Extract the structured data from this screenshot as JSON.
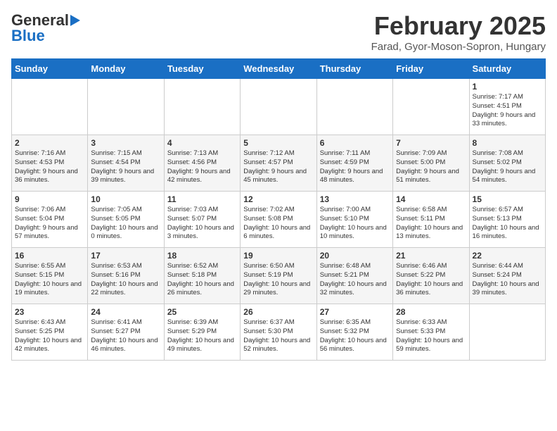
{
  "header": {
    "logo_general": "General",
    "logo_blue": "Blue",
    "month": "February 2025",
    "location": "Farad, Gyor-Moson-Sopron, Hungary"
  },
  "weekdays": [
    "Sunday",
    "Monday",
    "Tuesday",
    "Wednesday",
    "Thursday",
    "Friday",
    "Saturday"
  ],
  "weeks": [
    [
      {
        "day": "",
        "info": ""
      },
      {
        "day": "",
        "info": ""
      },
      {
        "day": "",
        "info": ""
      },
      {
        "day": "",
        "info": ""
      },
      {
        "day": "",
        "info": ""
      },
      {
        "day": "",
        "info": ""
      },
      {
        "day": "1",
        "info": "Sunrise: 7:17 AM\nSunset: 4:51 PM\nDaylight: 9 hours and 33 minutes."
      }
    ],
    [
      {
        "day": "2",
        "info": "Sunrise: 7:16 AM\nSunset: 4:53 PM\nDaylight: 9 hours and 36 minutes."
      },
      {
        "day": "3",
        "info": "Sunrise: 7:15 AM\nSunset: 4:54 PM\nDaylight: 9 hours and 39 minutes."
      },
      {
        "day": "4",
        "info": "Sunrise: 7:13 AM\nSunset: 4:56 PM\nDaylight: 9 hours and 42 minutes."
      },
      {
        "day": "5",
        "info": "Sunrise: 7:12 AM\nSunset: 4:57 PM\nDaylight: 9 hours and 45 minutes."
      },
      {
        "day": "6",
        "info": "Sunrise: 7:11 AM\nSunset: 4:59 PM\nDaylight: 9 hours and 48 minutes."
      },
      {
        "day": "7",
        "info": "Sunrise: 7:09 AM\nSunset: 5:00 PM\nDaylight: 9 hours and 51 minutes."
      },
      {
        "day": "8",
        "info": "Sunrise: 7:08 AM\nSunset: 5:02 PM\nDaylight: 9 hours and 54 minutes."
      }
    ],
    [
      {
        "day": "9",
        "info": "Sunrise: 7:06 AM\nSunset: 5:04 PM\nDaylight: 9 hours and 57 minutes."
      },
      {
        "day": "10",
        "info": "Sunrise: 7:05 AM\nSunset: 5:05 PM\nDaylight: 10 hours and 0 minutes."
      },
      {
        "day": "11",
        "info": "Sunrise: 7:03 AM\nSunset: 5:07 PM\nDaylight: 10 hours and 3 minutes."
      },
      {
        "day": "12",
        "info": "Sunrise: 7:02 AM\nSunset: 5:08 PM\nDaylight: 10 hours and 6 minutes."
      },
      {
        "day": "13",
        "info": "Sunrise: 7:00 AM\nSunset: 5:10 PM\nDaylight: 10 hours and 10 minutes."
      },
      {
        "day": "14",
        "info": "Sunrise: 6:58 AM\nSunset: 5:11 PM\nDaylight: 10 hours and 13 minutes."
      },
      {
        "day": "15",
        "info": "Sunrise: 6:57 AM\nSunset: 5:13 PM\nDaylight: 10 hours and 16 minutes."
      }
    ],
    [
      {
        "day": "16",
        "info": "Sunrise: 6:55 AM\nSunset: 5:15 PM\nDaylight: 10 hours and 19 minutes."
      },
      {
        "day": "17",
        "info": "Sunrise: 6:53 AM\nSunset: 5:16 PM\nDaylight: 10 hours and 22 minutes."
      },
      {
        "day": "18",
        "info": "Sunrise: 6:52 AM\nSunset: 5:18 PM\nDaylight: 10 hours and 26 minutes."
      },
      {
        "day": "19",
        "info": "Sunrise: 6:50 AM\nSunset: 5:19 PM\nDaylight: 10 hours and 29 minutes."
      },
      {
        "day": "20",
        "info": "Sunrise: 6:48 AM\nSunset: 5:21 PM\nDaylight: 10 hours and 32 minutes."
      },
      {
        "day": "21",
        "info": "Sunrise: 6:46 AM\nSunset: 5:22 PM\nDaylight: 10 hours and 36 minutes."
      },
      {
        "day": "22",
        "info": "Sunrise: 6:44 AM\nSunset: 5:24 PM\nDaylight: 10 hours and 39 minutes."
      }
    ],
    [
      {
        "day": "23",
        "info": "Sunrise: 6:43 AM\nSunset: 5:25 PM\nDaylight: 10 hours and 42 minutes."
      },
      {
        "day": "24",
        "info": "Sunrise: 6:41 AM\nSunset: 5:27 PM\nDaylight: 10 hours and 46 minutes."
      },
      {
        "day": "25",
        "info": "Sunrise: 6:39 AM\nSunset: 5:29 PM\nDaylight: 10 hours and 49 minutes."
      },
      {
        "day": "26",
        "info": "Sunrise: 6:37 AM\nSunset: 5:30 PM\nDaylight: 10 hours and 52 minutes."
      },
      {
        "day": "27",
        "info": "Sunrise: 6:35 AM\nSunset: 5:32 PM\nDaylight: 10 hours and 56 minutes."
      },
      {
        "day": "28",
        "info": "Sunrise: 6:33 AM\nSunset: 5:33 PM\nDaylight: 10 hours and 59 minutes."
      },
      {
        "day": "",
        "info": ""
      }
    ]
  ]
}
